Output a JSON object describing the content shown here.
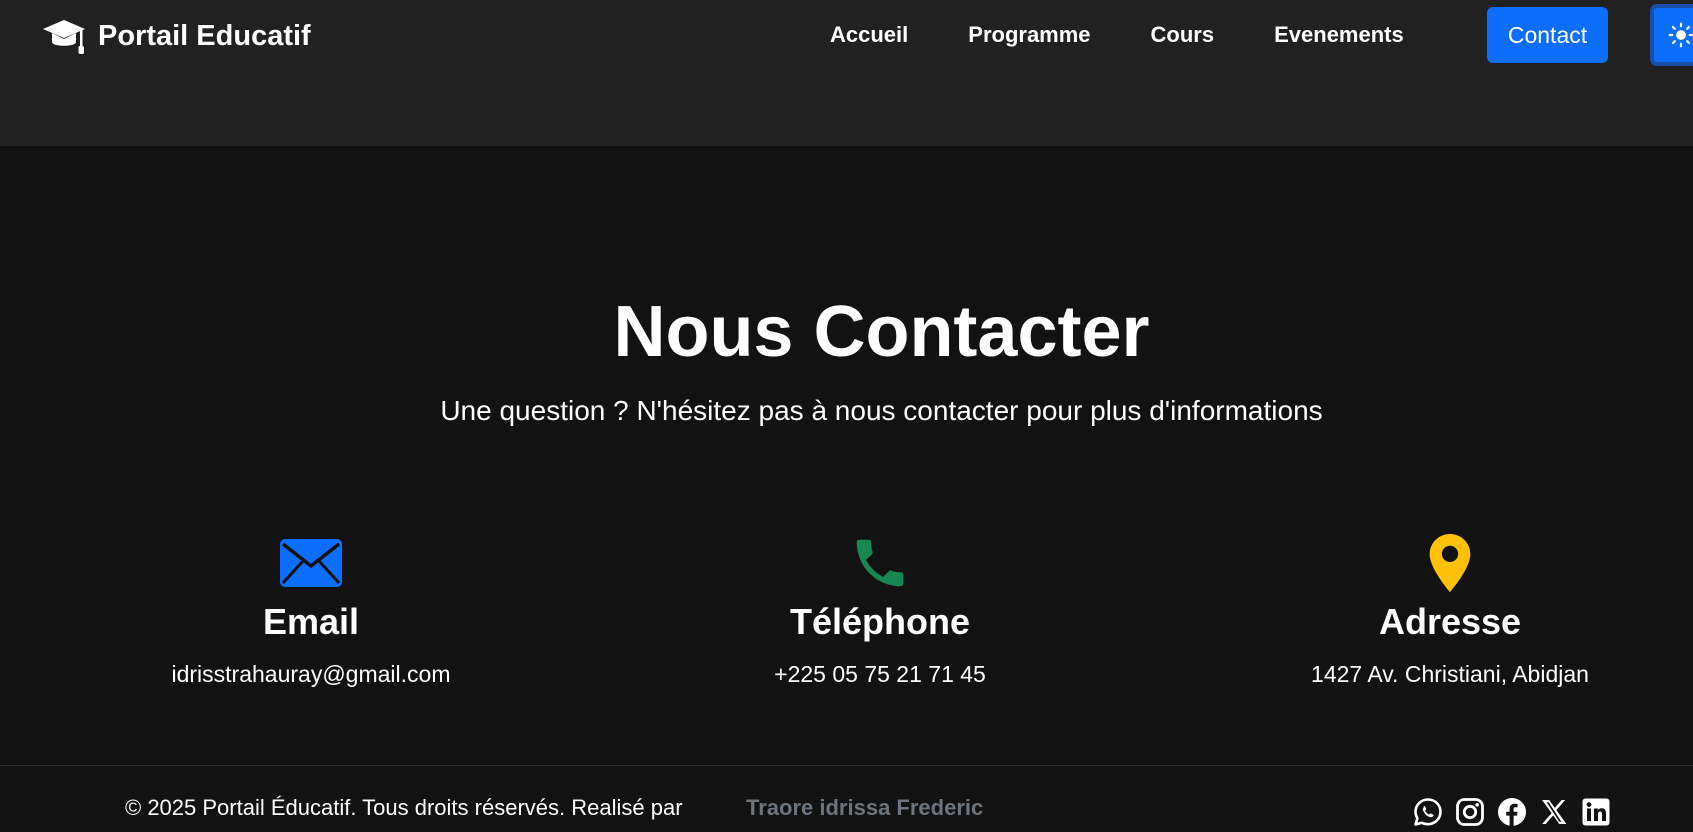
{
  "brand": {
    "name": "Portail Educatif",
    "icon": "graduation-cap-icon"
  },
  "nav": {
    "links": [
      {
        "label": "Accueil"
      },
      {
        "label": "Programme"
      },
      {
        "label": "Cours"
      },
      {
        "label": "Evenements"
      }
    ],
    "contact_label": "Contact",
    "theme_icon": "sun-icon"
  },
  "hero": {
    "title": "Nous Contacter",
    "subtitle": "Une question ? N'hésitez pas à nous contacter pour plus d'informations"
  },
  "contacts": [
    {
      "icon": "envelope-icon",
      "icon_color": "#0d6efd",
      "title": "Email",
      "value": "idrisstrahauray@gmail.com"
    },
    {
      "icon": "phone-icon",
      "icon_color": "#198754",
      "title": "Téléphone",
      "value": "+225 05 75 21 71 45"
    },
    {
      "icon": "map-pin-icon",
      "icon_color": "#ffc107",
      "title": "Adresse",
      "value": "1427 Av. Christiani, Abidjan"
    }
  ],
  "footer": {
    "copyright": "© 2025 Portail Éducatif. Tous droits réservés. Realisé par",
    "author": "Traore idrissa Frederic",
    "socials": [
      "whatsapp-icon",
      "instagram-icon",
      "facebook-icon",
      "x-icon",
      "linkedin-icon"
    ]
  },
  "colors": {
    "accent": "#0d6efd",
    "navbar_bg": "#212121",
    "page_bg": "#121212",
    "author_text": "#6c757d"
  }
}
